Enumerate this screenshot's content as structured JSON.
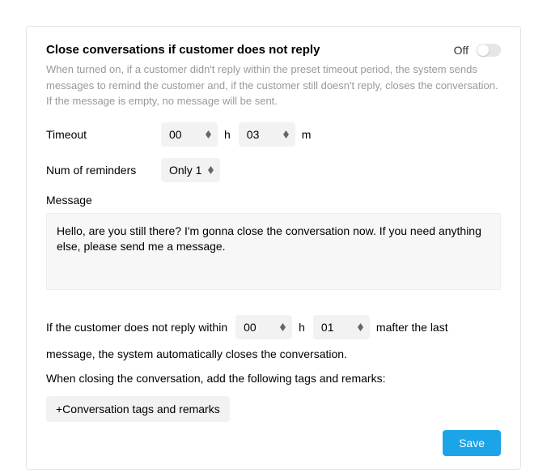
{
  "title": "Close conversations if customer does not reply",
  "toggle_state": "Off",
  "description": "When turned on, if a customer didn't reply within the preset timeout period, the system sends messages to remind the customer and, if the customer still doesn't reply, closes the conversation. If the message is empty, no message will be sent.",
  "timeout": {
    "label": "Timeout",
    "hours": "00",
    "unit_h": "h",
    "minutes": "03",
    "unit_m": "m"
  },
  "reminders": {
    "label": "Num of reminders",
    "value": "Only 1"
  },
  "message": {
    "label": "Message",
    "value": "Hello, are you still there? I'm gonna close the conversation now. If you need anything else, please send me a message."
  },
  "auto_close": {
    "text_before": "If the customer does not reply within",
    "hours": "00",
    "unit_h": "h",
    "minutes": "01",
    "text_after_unit": "mafter the last",
    "text_line2": "message, the system automatically closes the conversation."
  },
  "tags_section": {
    "label": "When closing the conversation, add the following tags and remarks:",
    "button": "+Conversation tags and remarks"
  },
  "save": "Save"
}
